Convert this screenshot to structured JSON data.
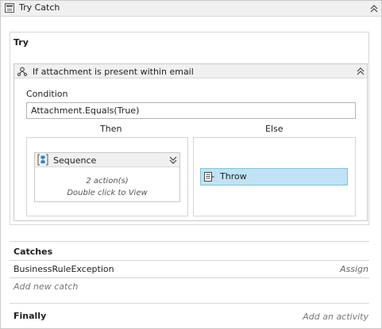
{
  "header": {
    "title": "Try Catch",
    "icon": "try-catch-icon",
    "collapse_icon": "double-chevron-up-icon"
  },
  "try_section": {
    "label": "Try"
  },
  "if_activity": {
    "title": "If attachment is present within email",
    "icon": "if-branch-icon",
    "condition_label": "Condition",
    "condition_value": "Attachment.Equals(True)",
    "then_label": "Then",
    "else_label": "Else"
  },
  "sequence": {
    "title": "Sequence",
    "icon": "sequence-icon",
    "expand_icon": "double-chevron-down-icon",
    "actions_text": "2 action(s)",
    "hint_text": "Double click to View"
  },
  "throw": {
    "label": "Throw",
    "icon": "throw-icon"
  },
  "catches": {
    "label": "Catches",
    "items": [
      {
        "exception": "BusinessRuleException",
        "action": "Assign"
      }
    ],
    "add_label": "Add new catch"
  },
  "finally": {
    "label": "Finally",
    "add_label": "Add an activity"
  },
  "colors": {
    "selected_bg": "#bfe3f4",
    "selected_border": "#86c1dd",
    "header_bg": "#f0f0f0"
  }
}
